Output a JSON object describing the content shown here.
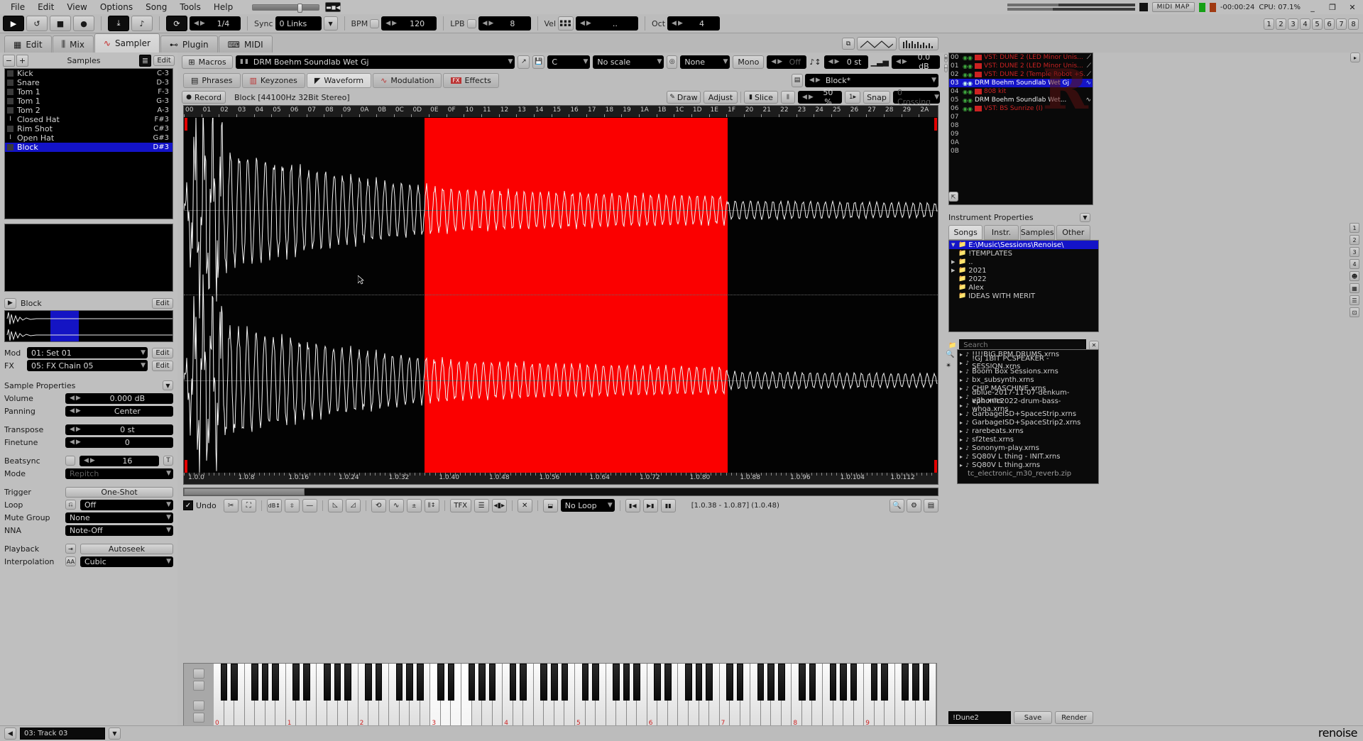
{
  "menu": {
    "items": [
      "File",
      "Edit",
      "View",
      "Options",
      "Song",
      "Tools",
      "Help"
    ]
  },
  "topbar": {
    "midi_map": "MIDI MAP",
    "time": "-00:00:24",
    "cpu": "CPU: 07.1%",
    "minimize": "_",
    "restore": "❐",
    "close": "✕"
  },
  "transport": {
    "play": "▶",
    "loop": "↺",
    "stop": "■",
    "record": "●",
    "follow": "⤓",
    "metronome": "♪",
    "edit_step_label": "1/4",
    "sync_label": "Sync",
    "sync_value": "0 Links",
    "bpm_label": "BPM",
    "bpm_value": "120",
    "lpb_label": "LPB",
    "lpb_value": "8",
    "vel_label": "Vel",
    "vel_value": "..",
    "oct_label": "Oct",
    "oct_value": "4"
  },
  "pattern_tabs": [
    "1",
    "2",
    "3",
    "4",
    "5",
    "6",
    "7",
    "8"
  ],
  "main_tabs": [
    {
      "label": "Edit",
      "icon": "grid-icon",
      "active": false
    },
    {
      "label": "Mix",
      "icon": "sliders-icon",
      "active": false
    },
    {
      "label": "Sampler",
      "icon": "waveform-icon",
      "active": true
    },
    {
      "label": "Plugin",
      "icon": "plug-icon",
      "active": false
    },
    {
      "label": "MIDI",
      "icon": "midi-icon",
      "active": false
    }
  ],
  "sampler": {
    "samples_title": "Samples",
    "add_label": "+",
    "remove_label": "−",
    "edit_label": "Edit",
    "sample_list": [
      {
        "name": "Kick",
        "note": "C-3",
        "icon": "block",
        "selected": false
      },
      {
        "name": "Snare",
        "note": "D-3",
        "icon": "block",
        "selected": false
      },
      {
        "name": "Tom 1",
        "note": "F-3",
        "icon": "block",
        "selected": false
      },
      {
        "name": "Tom 1",
        "note": "G-3",
        "icon": "block",
        "selected": false
      },
      {
        "name": "Tom 2",
        "note": "A-3",
        "icon": "block",
        "selected": false
      },
      {
        "name": "Closed Hat",
        "note": "F#3",
        "icon": "line",
        "selected": false
      },
      {
        "name": "Rim Shot",
        "note": "C#3",
        "icon": "block",
        "selected": false
      },
      {
        "name": "Open Hat",
        "note": "G#3",
        "icon": "line",
        "selected": false
      },
      {
        "name": "Block",
        "note": "D#3",
        "icon": "block",
        "selected": true
      }
    ],
    "current_sample": "Block",
    "mod_label": "Mod",
    "mod_value": "01: Set 01",
    "fx_label": "FX",
    "fx_value": "05: FX Chain 05",
    "properties_title": "Sample Properties",
    "properties": [
      {
        "key": "Volume",
        "value": "0.000 dB",
        "type": "spin"
      },
      {
        "key": "Panning",
        "value": "Center",
        "type": "spin"
      },
      {
        "key": "Transpose",
        "value": "0 st",
        "type": "spin"
      },
      {
        "key": "Finetune",
        "value": "0",
        "type": "spin"
      },
      {
        "key": "Beatsync",
        "value": "16",
        "type": "spin-check"
      },
      {
        "key": "Mode",
        "value": "Repitch",
        "type": "dim"
      },
      {
        "key": "Trigger",
        "value": "One-Shot",
        "type": "button"
      },
      {
        "key": "Loop",
        "value": "Off",
        "type": "dropdown"
      },
      {
        "key": "Mute Group",
        "value": "None",
        "type": "dropdown"
      },
      {
        "key": "NNA",
        "value": "Note-Off",
        "type": "dropdown"
      },
      {
        "key": "Playback",
        "value": "Autoseek",
        "type": "button"
      },
      {
        "key": "Interpolation",
        "value": "Cubic",
        "type": "dropdown"
      }
    ],
    "beatsync_unit": "T"
  },
  "instr_header": {
    "macros_label": "Macros",
    "instrument_name": "DRM Boehm Soundlab Wet Gj",
    "key_value": "C",
    "scale_value": "No scale",
    "phrase_value": "None",
    "mono_label": "Mono",
    "glide_value": "Off",
    "transpose_value": "0 st",
    "volume_value": "0.0 dB"
  },
  "sub_tabs": [
    {
      "label": "Phrases",
      "icon": "phrases-icon",
      "active": false
    },
    {
      "label": "Keyzones",
      "icon": "keyzones-icon",
      "active": false
    },
    {
      "label": "Waveform",
      "icon": "waveform-icon",
      "active": true
    },
    {
      "label": "Modulation",
      "icon": "modulation-icon",
      "active": false
    },
    {
      "label": "Effects",
      "icon": "fx-icon",
      "active": false
    }
  ],
  "waveform_selector": {
    "value": "Block*"
  },
  "waveform_toolbar": {
    "record_label": "Record",
    "sample_info": "Block [44100Hz 32Bit Stereo]",
    "draw_label": "Draw",
    "adjust_label": "Adjust",
    "slice_label": "Slice",
    "zoom_value": "50 %",
    "zoom_steps": "1",
    "snap_label": "Snap",
    "snap_value": "0 Crossing"
  },
  "ruler_top": [
    "00",
    "01",
    "02",
    "03",
    "04",
    "05",
    "06",
    "07",
    "08",
    "09",
    "0A",
    "0B",
    "0C",
    "0D",
    "0E",
    "0F",
    "10",
    "11",
    "12",
    "13",
    "14",
    "15",
    "16",
    "17",
    "18",
    "19",
    "1A",
    "1B",
    "1C",
    "1D",
    "1E",
    "1F",
    "20",
    "21",
    "22",
    "23",
    "24",
    "25",
    "26",
    "27",
    "28",
    "29",
    "2A"
  ],
  "ruler_bottom": [
    "1.0.0",
    "1.0.8",
    "1.0.16",
    "1.0.24",
    "1.0.32",
    "1.0.40",
    "1.0.48",
    "1.0.56",
    "1.0.64",
    "1.0.72",
    "1.0.80",
    "1.0.88",
    "1.0.96",
    "1.0.104",
    "1.0.112"
  ],
  "wave_bottom_toolbar": {
    "undo_label": "Undo",
    "cut_icon": "scissors-icon",
    "crop_icon": "crop-icon",
    "db_icon": "db-icon",
    "normalize_icon": "normalize-icon",
    "silence_icon": "silence-icon",
    "fadein_icon": "fade-in-icon",
    "fadeout_icon": "fade-out-icon",
    "reverse_icon": "reverse-icon",
    "smooth_icon": "smooth-icon",
    "amplify_icon": "amplify-icon",
    "eq_icon": "eq-icon",
    "tfx_label": "TFX",
    "list_icon": "list-icon",
    "wave_icon": "wave-icon",
    "x_icon": "close-x-icon",
    "loop_value": "No Loop",
    "selection_info": "[1.0.38 - 1.0.87] (1.0.48)"
  },
  "instrument_list": [
    {
      "idx": "00",
      "name": "VST: DUNE 2 (LED Minor Unis...",
      "color": "red",
      "selected": false,
      "muted": true,
      "wave": false
    },
    {
      "idx": "01",
      "name": "VST: DUNE 2 (LED Minor Unis...",
      "color": "red",
      "selected": false,
      "muted": false,
      "wave": false
    },
    {
      "idx": "02",
      "name": "VST: DUNE 2 (Temple Robot +S...",
      "color": "red",
      "selected": false,
      "muted": false,
      "wave": false
    },
    {
      "idx": "03",
      "name": "DRM Boehm Soundlab Wet Gj",
      "color": "white",
      "selected": true,
      "muted": false,
      "wave": true
    },
    {
      "idx": "04",
      "name": "808 kit",
      "color": "red",
      "selected": false,
      "muted": false,
      "wave": false
    },
    {
      "idx": "05",
      "name": "DRM Boehm Soundlab Wet...",
      "color": "white",
      "selected": false,
      "muted": false,
      "wave": true
    },
    {
      "idx": "06",
      "name": "VST: BS Sunrize (I)",
      "color": "red",
      "selected": false,
      "muted": false,
      "wave": false
    },
    {
      "idx": "07",
      "name": "",
      "color": "red",
      "selected": false,
      "muted": false,
      "wave": false
    },
    {
      "idx": "08",
      "name": "",
      "color": "red",
      "selected": false,
      "muted": false,
      "wave": false
    },
    {
      "idx": "09",
      "name": "",
      "color": "red",
      "selected": false,
      "muted": false,
      "wave": false
    },
    {
      "idx": "0A",
      "name": "",
      "color": "red",
      "selected": false,
      "muted": false,
      "wave": false
    },
    {
      "idx": "0B",
      "name": "",
      "color": "red",
      "selected": false,
      "muted": false,
      "wave": false
    }
  ],
  "instrument_properties_title": "Instrument Properties",
  "browser_tabs": [
    {
      "label": "Songs",
      "active": true
    },
    {
      "label": "Instr.",
      "active": false
    },
    {
      "label": "Samples",
      "active": false
    },
    {
      "label": "Other",
      "active": false
    }
  ],
  "folder_tree": [
    {
      "label": "E:\\Music\\Sessions\\Renoise\\",
      "depth": 0,
      "selected": true,
      "expanded": true,
      "icon": "folder-open-icon"
    },
    {
      "label": "!TEMPLATES",
      "depth": 1,
      "selected": false,
      "expanded": false,
      "icon": "folder-icon"
    },
    {
      "label": "..",
      "depth": 1,
      "selected": false,
      "expanded": false,
      "icon": "folder-icon"
    },
    {
      "label": "2021",
      "depth": 1,
      "selected": false,
      "expanded": true,
      "icon": "folder-icon"
    },
    {
      "label": "2022",
      "depth": 1,
      "selected": false,
      "expanded": false,
      "icon": "folder-icon"
    },
    {
      "label": "Alex",
      "depth": 1,
      "selected": false,
      "expanded": false,
      "icon": "folder-icon"
    },
    {
      "label": "IDEAS WITH MERIT",
      "depth": 1,
      "selected": false,
      "expanded": false,
      "icon": "folder-icon"
    }
  ],
  "search": {
    "placeholder": "Search",
    "value": "",
    "icon": "search-icon",
    "clear_icon": "close-icon"
  },
  "file_list": [
    {
      "name": "!!!!BIG BPM DRUMS.xrns",
      "type": "song"
    },
    {
      "name": "!GJ 1BIT PCSPEAKER - SESSION.xrns",
      "type": "song"
    },
    {
      "name": "Boom Box Sessions.xrns",
      "type": "song"
    },
    {
      "name": "bx_subsynth.xrns",
      "type": "song"
    },
    {
      "name": "CHIP MASCHINE.xrns",
      "type": "song"
    },
    {
      "name": "dblue-2017-11-07-denkum-v3b.xrns",
      "type": "song"
    },
    {
      "name": "ephonic2022-drum-bass-whoa.xrns",
      "type": "song"
    },
    {
      "name": "GarbageISD+SpaceStrip.xrns",
      "type": "song"
    },
    {
      "name": "GarbageISD+SpaceStrip2.xrns",
      "type": "song"
    },
    {
      "name": "rarebeats.xrns",
      "type": "song"
    },
    {
      "name": "sf2test.xrns",
      "type": "song"
    },
    {
      "name": "Sononym-play.xrns",
      "type": "song"
    },
    {
      "name": "SQ80V L thing - INIT.xrns",
      "type": "song"
    },
    {
      "name": "SQ80V L thing.xrns",
      "type": "song"
    },
    {
      "name": "tc_electronic_m30_reverb.zip",
      "type": "zip"
    }
  ],
  "browser_footer": {
    "name_value": "!Dune2",
    "save_label": "Save",
    "render_label": "Render"
  },
  "statusbar": {
    "track_value": "03: Track 03",
    "brand": "renoise"
  },
  "keyboard": {
    "octave_labels": [
      "0",
      "1",
      "2",
      "3",
      "4",
      "5",
      "6",
      "7",
      "8",
      "9"
    ]
  },
  "colors": {
    "selection_red": "#fb0000",
    "selection_blue": "#1313c8",
    "accent_red": "#cc2222",
    "bg": "#bfbfbf",
    "panel_black": "#050505"
  }
}
